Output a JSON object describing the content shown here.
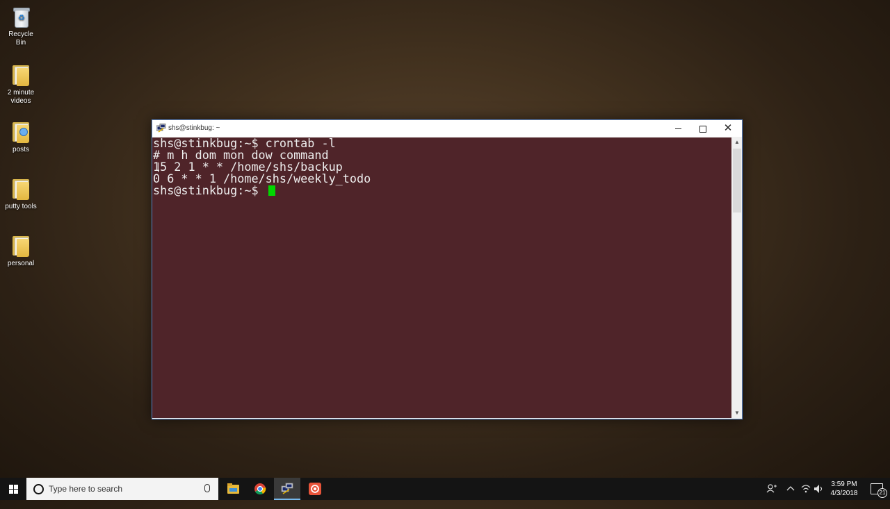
{
  "desktop": {
    "icons": [
      {
        "label": "Recycle Bin",
        "icon": "recycle-bin-icon"
      },
      {
        "label": "2 minute videos",
        "icon": "folder-icon"
      },
      {
        "label": "posts",
        "icon": "folder-icon"
      },
      {
        "label": "putty tools",
        "icon": "folder-icon"
      },
      {
        "label": "personal",
        "icon": "folder-icon"
      }
    ]
  },
  "window": {
    "title": "shs@stinkbug: ~",
    "app_icon": "putty-icon",
    "controls": {
      "minimize": "minimize-icon",
      "maximize": "maximize-icon",
      "close": "✕"
    },
    "terminal": {
      "lines": [
        "shs@stinkbug:~$ crontab -l",
        "# m h dom mon dow command",
        "15 2 1 * * /home/shs/backup",
        "0 6 * * 1 /home/shs/weekly_todo",
        "shs@stinkbug:~$ "
      ],
      "background": "#4f2429",
      "foreground": "#eeeeee",
      "cursor_color": "#00d700"
    }
  },
  "taskbar": {
    "search_placeholder": "Type here to search",
    "apps": [
      "file-explorer-icon",
      "chrome-icon",
      "putty-icon",
      "screen-recorder-icon"
    ],
    "tray": {
      "icons": [
        "people-icon",
        "chevron-up-icon",
        "wifi-icon",
        "volume-icon"
      ],
      "time": "3:59 PM",
      "date": "4/3/2018",
      "notification_count": "21"
    }
  }
}
